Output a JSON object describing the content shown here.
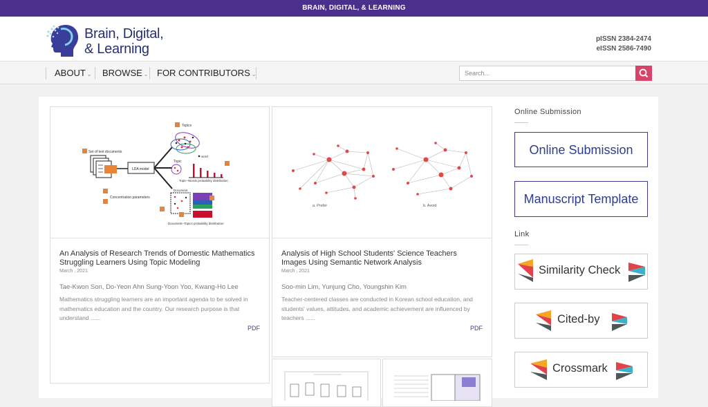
{
  "topbar": {
    "title": "BRAIN, DIGITAL, & LEARNING"
  },
  "header": {
    "logo_line1": "Brain, Digital,",
    "logo_line2": "& Learning",
    "pissn": "pISSN 2384-2474",
    "eissn": "eISSN 2586-7490"
  },
  "nav": {
    "items": [
      {
        "label": "ABOUT"
      },
      {
        "label": "BROWSE"
      },
      {
        "label": "FOR CONTRIBUTORS"
      }
    ],
    "search_placeholder": "Search..."
  },
  "articles": [
    {
      "title": "An Analysis of Research Trends of Domestic Mathematics Struggling Learners Using Topic Modeling",
      "date": "March , 2021",
      "authors": "Tae-Kwon Son, Do-Yeon Ahn Sung-Yoon Yoo, Kwang-Ho Lee",
      "abstract": "Mathematics struggling learners are an important agenda to be solved in mathematics education and the country. Our research purpose is that understand ......",
      "pdf": "PDF",
      "figure": {
        "set_docs": "Set of text documents",
        "lda": "LDA model",
        "topics": "Topics",
        "topic": "Topic",
        "word": "word",
        "topic_words": "Topic–Words probability distribution",
        "concentration": "Concentration parameters",
        "document": "Document",
        "doc_topics": "Document–Topics probability distribution"
      }
    },
    {
      "title": "Analysis of High School Students' Science Teachers Images Using Semantic Network Analysis",
      "date": "March , 2021",
      "authors": "Soo-min Lim, Yunjung Cho, Youngshin Kim",
      "abstract": "Teacher-centered classes are conducted in Korean school education, and students' values, attitudes, and academic achievement are influenced by teachers ......",
      "pdf": "PDF",
      "figure": {
        "label_a": "a.  Prefer",
        "label_b": "b.  Avoid"
      }
    }
  ],
  "sidebar": {
    "online_submission_heading": "Online Submission",
    "online_submission_button": "Online Submission",
    "manuscript_template_button": "Manuscript Template",
    "link_heading": "Link",
    "links": [
      {
        "label": "Similarity Check"
      },
      {
        "label": "Cited-by"
      },
      {
        "label": "Crossmark"
      }
    ]
  },
  "colors": {
    "brand_purple": "#4b2f8c",
    "search_button": "#d9436a",
    "pdf_link": "#3f3b8e",
    "crossref_yellow": "#f5a623",
    "crossref_red": "#e2434b",
    "crossref_teal": "#3eb1c8",
    "crossref_grey": "#4f5858"
  }
}
